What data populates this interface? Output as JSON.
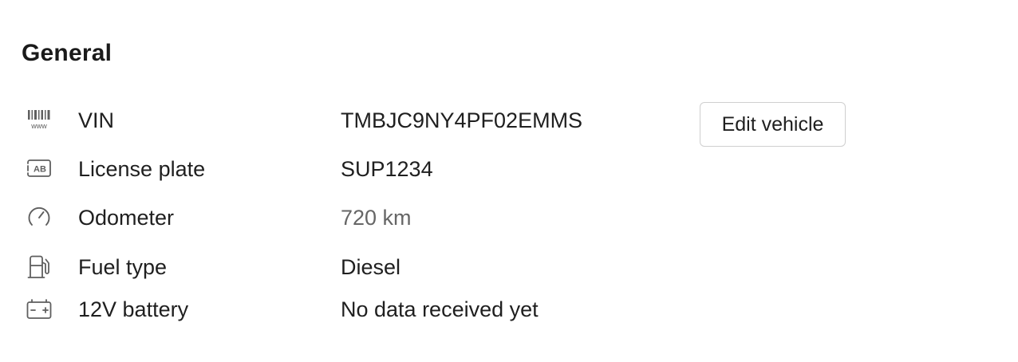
{
  "section": {
    "title": "General"
  },
  "actions": {
    "edit_vehicle_label": "Edit vehicle"
  },
  "rows": [
    {
      "icon": "barcode-icon",
      "label": "VIN",
      "value": "TMBJC9NY4PF02EMMS"
    },
    {
      "icon": "license-plate-icon",
      "label": "License plate",
      "value": "SUP1234"
    },
    {
      "icon": "speedometer-icon",
      "label": "Odometer",
      "value": "720 km"
    },
    {
      "icon": "fuel-pump-icon",
      "label": "Fuel type",
      "value": "Diesel"
    },
    {
      "icon": "battery-icon",
      "label": "12V battery",
      "value": "No data received yet"
    }
  ],
  "icons": {
    "barcode_caption": "www",
    "plate_caption": "AB"
  },
  "colors": {
    "text": "#1f1f1f",
    "muted_value": "#666666",
    "icon_stroke": "#5f5f5f",
    "button_border": "#cfcfcf"
  }
}
